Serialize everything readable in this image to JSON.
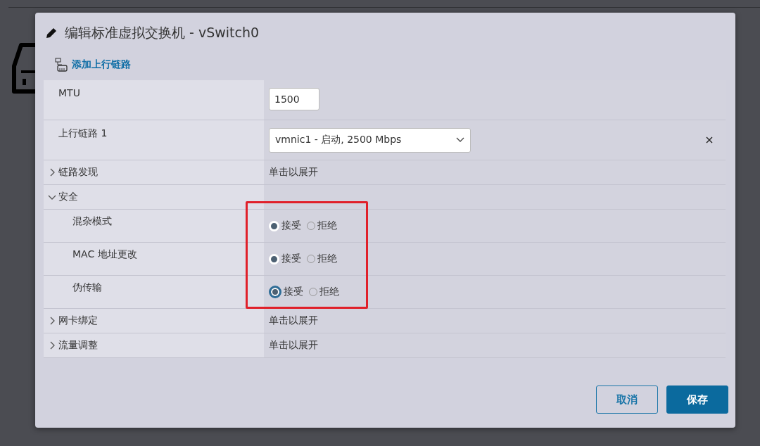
{
  "dialog": {
    "title": "编辑标准虚拟交换机 - vSwitch0"
  },
  "toolbar": {
    "add_uplink": "添加上行链路"
  },
  "rows": [
    {
      "kind": "field",
      "label": "MTU",
      "value": "1500"
    },
    {
      "kind": "select",
      "label": "上行链路 1",
      "value": "vmnic1 - 启动, 2500 Mbps",
      "removable": true
    },
    {
      "kind": "group",
      "label": "链路发现",
      "expanded": false,
      "hint": "单击以展开"
    },
    {
      "kind": "group",
      "label": "安全",
      "expanded": true,
      "children": [
        {
          "label": "混杂模式",
          "options": [
            {
              "label": "接受",
              "selected": true,
              "focused": false
            },
            {
              "label": "拒绝",
              "selected": false,
              "focused": false
            }
          ]
        },
        {
          "label": "MAC 地址更改",
          "options": [
            {
              "label": "接受",
              "selected": true,
              "focused": false
            },
            {
              "label": "拒绝",
              "selected": false,
              "focused": false
            }
          ]
        },
        {
          "label": "伪传输",
          "options": [
            {
              "label": "接受",
              "selected": true,
              "focused": true
            },
            {
              "label": "拒绝",
              "selected": false,
              "focused": false
            }
          ]
        }
      ]
    },
    {
      "kind": "group",
      "label": "网卡绑定",
      "expanded": false,
      "hint": "单击以展开"
    },
    {
      "kind": "group",
      "label": "流量调整",
      "expanded": false,
      "hint": "单击以展开"
    }
  ],
  "buttons": [
    {
      "kind": "secondary",
      "label": "取消"
    },
    {
      "kind": "primary",
      "label": "保存"
    }
  ]
}
